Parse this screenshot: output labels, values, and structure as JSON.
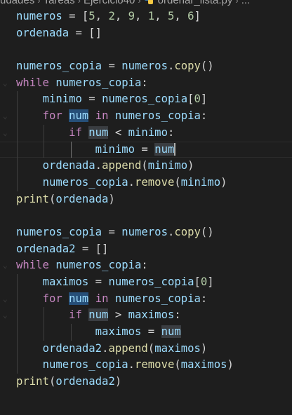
{
  "breadcrumb": {
    "items": [
      "udades",
      "Tareas",
      "Ejercicio40",
      "ordenar_lista.py",
      "..."
    ],
    "file_icon": "python-icon"
  },
  "code": {
    "l1": {
      "a": "numeros",
      "b": " = [",
      "c": "5",
      "d": ", ",
      "e": "2",
      "f": ", ",
      "g": "9",
      "h": ", ",
      "i": "1",
      "j": ", ",
      "k": "5",
      "l": ", ",
      "m": "6",
      "n": "]"
    },
    "l2": {
      "a": "ordenada",
      "b": " = []"
    },
    "l4": {
      "a": "numeros_copia",
      "b": " = ",
      "c": "numeros",
      "d": ".",
      "e": "copy",
      "f": "()"
    },
    "l5": {
      "a": "while",
      "b": " ",
      "c": "numeros_copia",
      "d": ":"
    },
    "l6": {
      "a": "minimo",
      "b": " = ",
      "c": "numeros_copia",
      "d": "[",
      "e": "0",
      "f": "]"
    },
    "l7": {
      "a": "for",
      "b": " ",
      "c": "num",
      "d": " ",
      "e": "in",
      "f": " ",
      "g": "numeros_copia",
      "h": ":"
    },
    "l8": {
      "a": "if",
      "b": " ",
      "c": "num",
      "d": " < ",
      "e": "minimo",
      "f": ":"
    },
    "l9": {
      "a": "minimo",
      "b": " = ",
      "c": "num"
    },
    "l10": {
      "a": "ordenada",
      "b": ".",
      "c": "append",
      "d": "(",
      "e": "minimo",
      "f": ")"
    },
    "l11": {
      "a": "numeros_copia",
      "b": ".",
      "c": "remove",
      "d": "(",
      "e": "minimo",
      "f": ")"
    },
    "l12": {
      "a": "print",
      "b": "(",
      "c": "ordenada",
      "d": ")"
    },
    "l14": {
      "a": "numeros_copia",
      "b": " = ",
      "c": "numeros",
      "d": ".",
      "e": "copy",
      "f": "()"
    },
    "l15": {
      "a": "ordenada2",
      "b": " = []"
    },
    "l16": {
      "a": "while",
      "b": " ",
      "c": "numeros_copia",
      "d": ":"
    },
    "l17": {
      "a": "maximos",
      "b": " = ",
      "c": "numeros_copia",
      "d": "[",
      "e": "0",
      "f": "]"
    },
    "l18": {
      "a": "for",
      "b": " ",
      "c": "num",
      "d": " ",
      "e": "in",
      "f": " ",
      "g": "numeros_copia",
      "h": ":"
    },
    "l19": {
      "a": "if",
      "b": " ",
      "c": "num",
      "d": " > ",
      "e": "maximos",
      "f": ":"
    },
    "l20": {
      "a": "maximos",
      "b": " = ",
      "c": "num"
    },
    "l21": {
      "a": "ordenada2",
      "b": ".",
      "c": "append",
      "d": "(",
      "e": "maximos",
      "f": ")"
    },
    "l22": {
      "a": "numeros_copia",
      "b": ".",
      "c": "remove",
      "d": "(",
      "e": "maximos",
      "f": ")"
    },
    "l23": {
      "a": "print",
      "b": "(",
      "c": "ordenada2",
      "d": ")"
    }
  }
}
